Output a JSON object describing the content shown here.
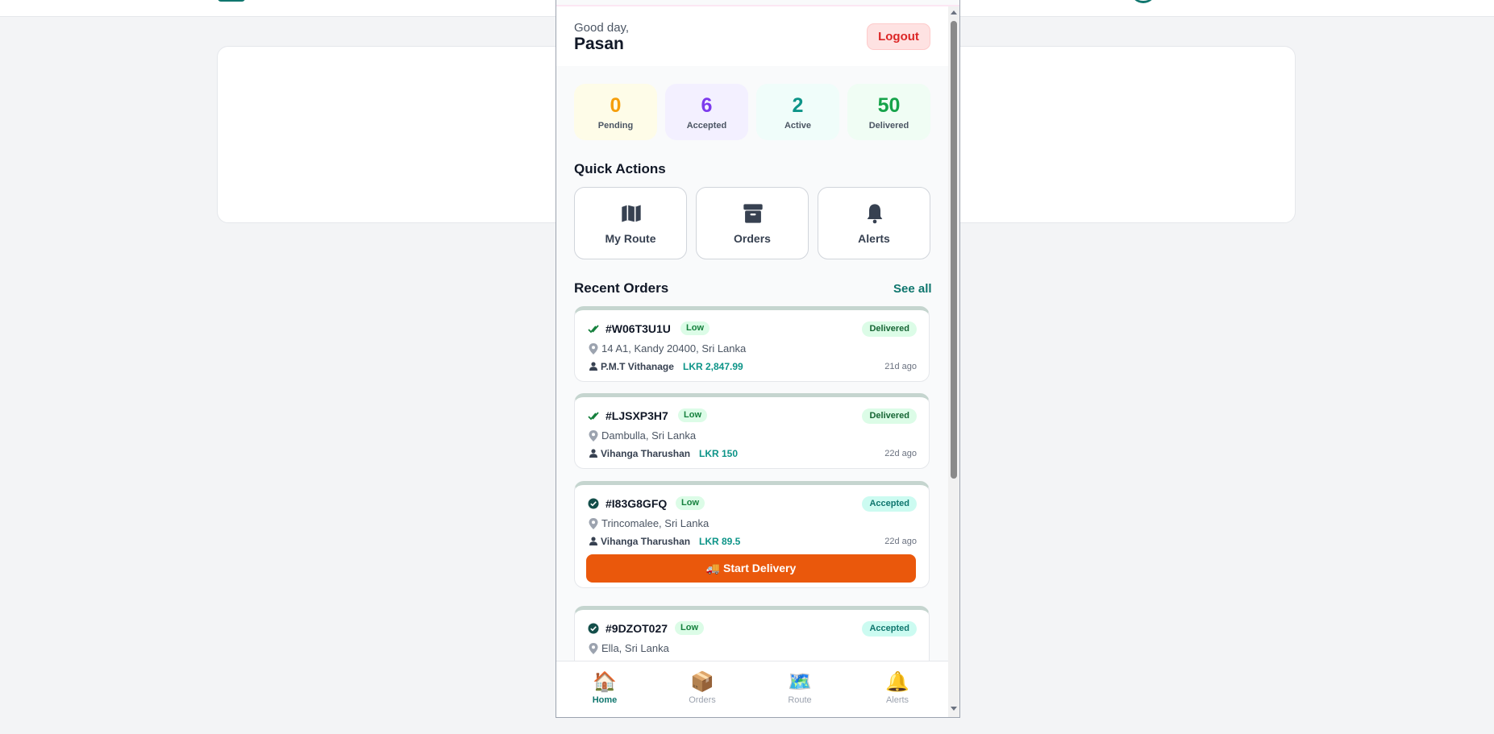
{
  "header": {
    "greeting": "Good day,",
    "user_name": "Pasan",
    "logout_label": "Logout"
  },
  "stats": [
    {
      "value": "0",
      "label": "Pending",
      "color": "#f59e0b",
      "bg": "#fefce8"
    },
    {
      "value": "6",
      "label": "Accepted",
      "color": "#7c3aed",
      "bg": "#f3f0ff"
    },
    {
      "value": "2",
      "label": "Active",
      "color": "#0d9488",
      "bg": "#f0fdfa"
    },
    {
      "value": "50",
      "label": "Delivered",
      "color": "#16a34a",
      "bg": "#f0fdf4"
    }
  ],
  "quick_actions": {
    "title": "Quick Actions",
    "items": [
      {
        "label": "My Route",
        "icon": "map-icon"
      },
      {
        "label": "Orders",
        "icon": "archive-icon"
      },
      {
        "label": "Alerts",
        "icon": "bell-icon"
      }
    ]
  },
  "recent_orders": {
    "title": "Recent Orders",
    "see_all": "See all",
    "orders": [
      {
        "id": "#W06T3U1U",
        "priority": "Low",
        "status": "Delivered",
        "address": "14 A1, Kandy 20400, Sri Lanka",
        "customer": "P.M.T Vithanage",
        "amount": "LKR 2,847.99",
        "ago": "21d ago"
      },
      {
        "id": "#LJSXP3H7",
        "priority": "Low",
        "status": "Delivered",
        "address": "Dambulla, Sri Lanka",
        "customer": "Vihanga Tharushan",
        "amount": "LKR 150",
        "ago": "22d ago"
      },
      {
        "id": "#I83G8GFQ",
        "priority": "Low",
        "status": "Accepted",
        "address": "Trincomalee, Sri Lanka",
        "customer": "Vihanga Tharushan",
        "amount": "LKR 89.5",
        "ago": "22d ago",
        "action": "🚚 Start Delivery"
      },
      {
        "id": "#9DZOT027",
        "priority": "Low",
        "status": "Accepted",
        "address": "Ella, Sri Lanka"
      }
    ]
  },
  "bottom_nav": [
    {
      "label": "Home",
      "icon": "🏠",
      "active": true
    },
    {
      "label": "Orders",
      "icon": "📦"
    },
    {
      "label": "Route",
      "icon": "🗺️"
    },
    {
      "label": "Alerts",
      "icon": "🔔"
    }
  ]
}
